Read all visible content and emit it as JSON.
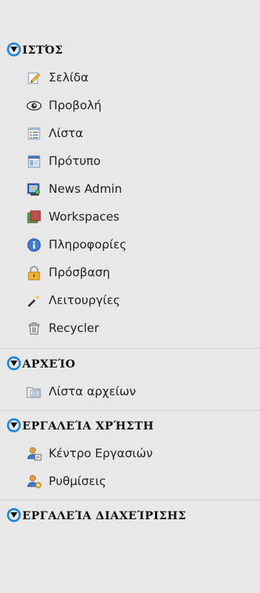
{
  "sections": [
    {
      "title": "ΙΣΤΌΣ",
      "items": [
        {
          "label": "Σελίδα",
          "icon": "page-edit-icon"
        },
        {
          "label": "Προβολή",
          "icon": "eye-icon"
        },
        {
          "label": "Λίστα",
          "icon": "list-icon"
        },
        {
          "label": "Πρότυπο",
          "icon": "template-icon"
        },
        {
          "label": "News Admin",
          "icon": "news-admin-icon"
        },
        {
          "label": "Workspaces",
          "icon": "workspaces-icon"
        },
        {
          "label": "Πληροφορίες",
          "icon": "info-icon"
        },
        {
          "label": "Πρόσβαση",
          "icon": "lock-icon"
        },
        {
          "label": "Λειτουργίες",
          "icon": "magic-wand-icon"
        },
        {
          "label": "Recycler",
          "icon": "trash-icon"
        }
      ]
    },
    {
      "title": "ΑΡΧΕΊΟ",
      "items": [
        {
          "label": "Λίστα αρχείων",
          "icon": "file-list-icon"
        }
      ]
    },
    {
      "title": "ΕΡΓΑΛΕΊΑ ΧΡΉΣΤΗ",
      "items": [
        {
          "label": "Κέντρο Εργασιών",
          "icon": "task-center-icon"
        },
        {
          "label": "Ρυθμίσεις",
          "icon": "user-settings-icon"
        }
      ]
    },
    {
      "title": "ΕΡΓΑΛΕΊΑ ΔΙΑΧΕΊΡΙΣΗΣ",
      "items": []
    }
  ],
  "colors": {
    "toggle_ring": "#1e88e5",
    "background": "#e8e8e8"
  }
}
